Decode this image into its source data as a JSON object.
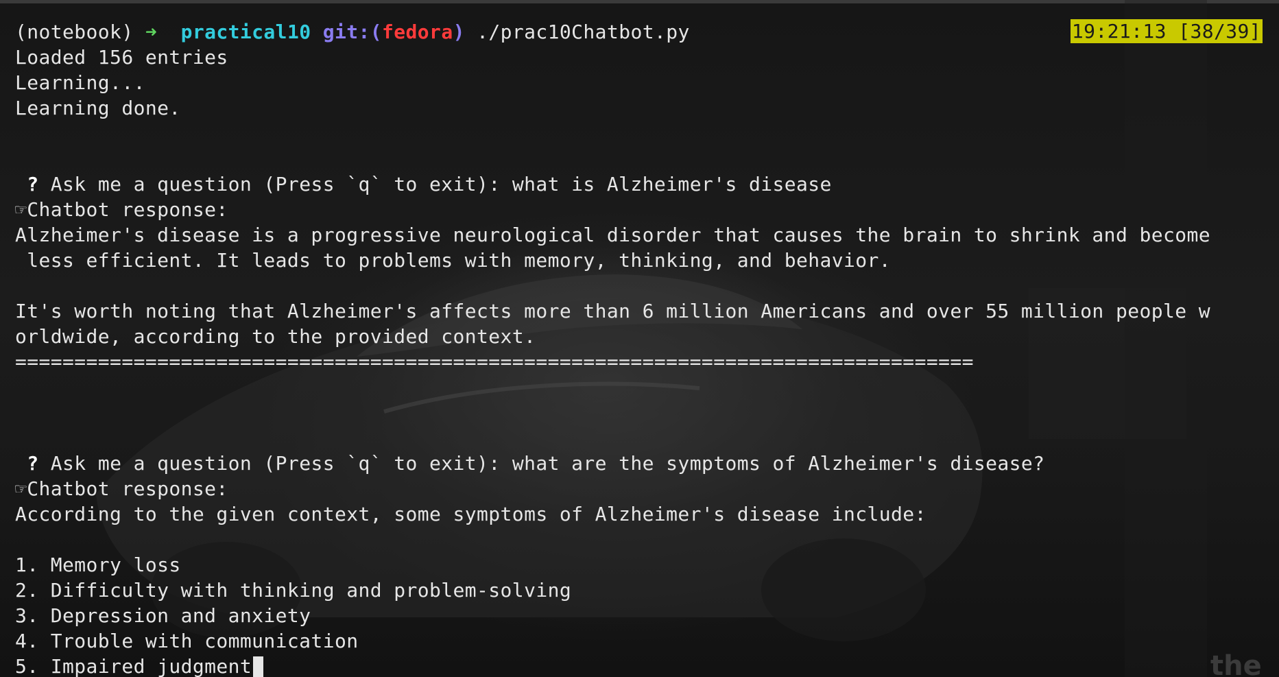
{
  "colors": {
    "background": "#141414",
    "text": "#e6e6e6",
    "prompt_arrow": "#5fd35f",
    "prompt_dir": "#33ccdd",
    "prompt_git": "#8a7cf0",
    "prompt_branch": "#ff3b3b",
    "clock_bg": "#c9c900"
  },
  "prompt": {
    "env": "(notebook) ",
    "arrow": "➜",
    "dir": "practical10",
    "git_open": "git:(",
    "branch": "fedora",
    "git_close": ")",
    "command": "./prac10Chatbot.py"
  },
  "status": {
    "clock": "19:21:13 [38/39]"
  },
  "output": {
    "loaded": "Loaded 156 entries",
    "learning": "Learning...",
    "learning_done": "Learning done.",
    "separator": "================================================================================="
  },
  "exchanges": [
    {
      "question_mark": "?",
      "question_prompt": " Ask me a question (Press `q` to exit): what is Alzheimer's disease",
      "response_icon": "☞",
      "response_label": "Chatbot response:",
      "answer_lines": [
        "Alzheimer's disease is a progressive neurological disorder that causes the brain to shrink and become",
        " less efficient. It leads to problems with memory, thinking, and behavior.",
        "",
        "It's worth noting that Alzheimer's affects more than 6 million Americans and over 55 million people w",
        "orldwide, according to the provided context."
      ]
    },
    {
      "question_mark": "?",
      "question_prompt": " Ask me a question (Press `q` to exit): what are the symptoms of Alzheimer's disease?",
      "response_icon": "☞",
      "response_label": "Chatbot response:",
      "answer_lines": [
        "According to the given context, some symptoms of Alzheimer's disease include:",
        "",
        "1. Memory loss",
        "2. Difficulty with thinking and problem-solving",
        "3. Depression and anxiety",
        "4. Trouble with communication",
        "5. Impaired judgment"
      ]
    }
  ],
  "wallpaper": {
    "watermark": "the"
  }
}
